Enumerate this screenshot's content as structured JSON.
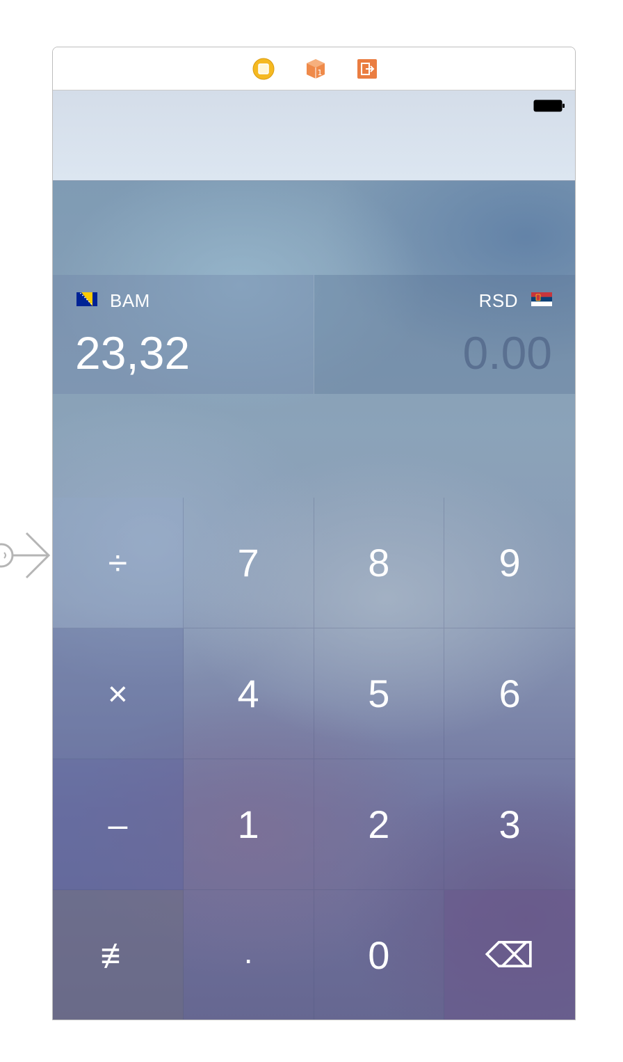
{
  "storyboard": {
    "dock_icons": [
      "view-controller-icon",
      "first-responder-icon",
      "exit-icon"
    ],
    "entry_arrow": "entry-point-arrow-icon"
  },
  "status_bar": {
    "battery_icon": "battery-icon"
  },
  "converter": {
    "from": {
      "currency": "BAM",
      "flag_icon": "bosnia-flag-icon",
      "amount": "23,32"
    },
    "to": {
      "currency": "RSD",
      "flag_icon": "serbia-flag-icon",
      "amount": "0.00"
    }
  },
  "keypad": {
    "rows": [
      [
        "÷",
        "7",
        "8",
        "9"
      ],
      [
        "×",
        "4",
        "5",
        "6"
      ],
      [
        "–",
        "1",
        "2",
        "3"
      ],
      [
        "⇟",
        ".",
        "0",
        "⌫"
      ]
    ],
    "keys": {
      "divide": "÷",
      "multiply": "×",
      "subtract": "–",
      "convert": "≢",
      "decimal": ".",
      "backspace": "⌫",
      "d0": "0",
      "d1": "1",
      "d2": "2",
      "d3": "3",
      "d4": "4",
      "d5": "5",
      "d6": "6",
      "d7": "7",
      "d8": "8",
      "d9": "9"
    }
  },
  "colors": {
    "dock_vc": "#f5b921",
    "dock_fr": "#ef8a4a",
    "dock_exit": "#ea7d41",
    "status_bg": "#d8e2ee",
    "amount_placeholder": "#4b5f82"
  }
}
